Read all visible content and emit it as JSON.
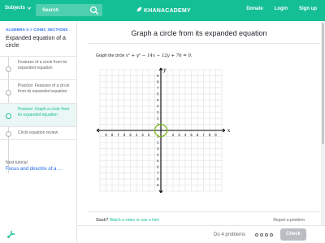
{
  "header": {
    "subjects": "Subjects",
    "search_placeholder": "Search",
    "logo": "KHANACADEMY",
    "links": [
      "Donate",
      "Login",
      "Sign up"
    ],
    "brand_color": "#14bf96"
  },
  "sidebar": {
    "breadcrumb": "ALGEBRA II > CONIC SECTIONS",
    "unit_title": "Expanded equation of a circle",
    "items": [
      {
        "label": "Features of a circle from its expanded equation",
        "active": false
      },
      {
        "label": "Practice: Features of a circle from its expanded equation",
        "active": false
      },
      {
        "label": "Practice: Graph a circle from its expanded equation",
        "active": true
      },
      {
        "label": "Circle equation review",
        "active": false
      }
    ],
    "next_caption": "Next tutorial",
    "next_link": "Focus and directrix of a ..."
  },
  "exercise": {
    "title": "Graph a circle from its expanded equation",
    "prompt": "Graph the circle",
    "equation": "x² + y² − 14x − 12y + 76 = 0.",
    "graph": {
      "x_label": "x",
      "y_label": "y",
      "x_ticks": [
        "9",
        "8",
        "7",
        "6",
        "5",
        "4",
        "3",
        "2",
        "",
        "2",
        "3",
        "4",
        "5",
        "6",
        "7",
        "8",
        "9"
      ],
      "y_ticks": [
        "9",
        "8",
        "7",
        "6",
        "5",
        "4",
        "3",
        "2",
        "1",
        "",
        "1",
        "2",
        "3",
        "4",
        "5",
        "6",
        "7",
        "8",
        "9"
      ],
      "range": [
        -10,
        10
      ],
      "circle_color": "#71b307",
      "circle_center": [
        0,
        0
      ],
      "circle_radius": 1
    },
    "stuck_text": "Stuck?",
    "stuck_link": "Watch a video or use a hint.",
    "report": "Report a problem"
  },
  "footer": {
    "progress": "Do 4 problems",
    "dots": 4,
    "check": "Check"
  }
}
